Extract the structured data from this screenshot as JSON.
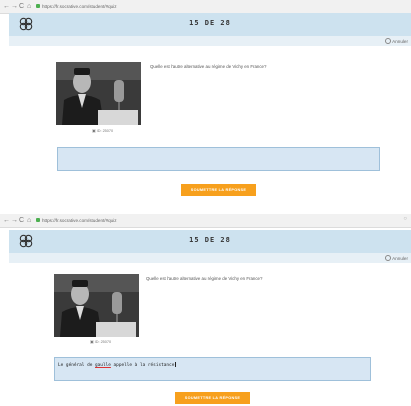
{
  "browser": {
    "nav_back": "←",
    "nav_forward": "→",
    "nav_reload": "C",
    "nav_home": "⌂",
    "url_1": "https://fr.socrative.com/student/#quiz",
    "url_2": "https://fr.socrative.com/student/#quiz"
  },
  "header": {
    "title": "15 DE 28",
    "action_label": "Annuler",
    "accent": "#cde2ef"
  },
  "question": {
    "text": "Quelle est l'autre alternative au régime de Vichy en France?",
    "photo_credit": "ID: 25070"
  },
  "answer": {
    "before": {
      "value": "",
      "placeholder": ""
    },
    "after": {
      "value_parts": [
        "Le général de ",
        "gaulle",
        " appelle à la résistance"
      ]
    }
  },
  "submit": {
    "label": "SOUMETTRE LA RÉPONSE",
    "color": "#f7a01d"
  },
  "icons": {
    "logo": "socrative-logo-icon",
    "credit": "image-credit-icon",
    "action": "cancel-icon"
  }
}
